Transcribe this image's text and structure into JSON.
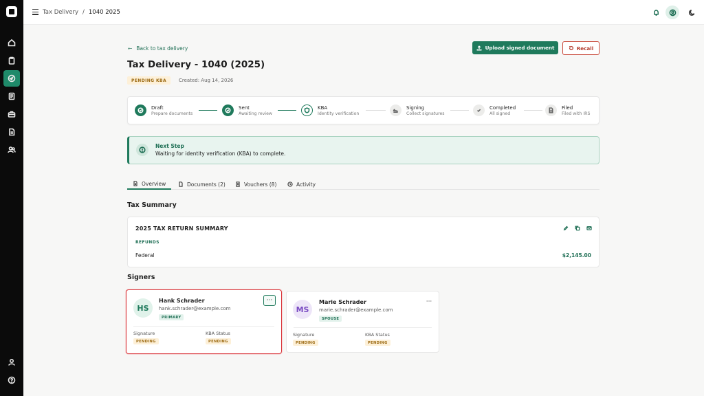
{
  "sidebar": {
    "items": [
      {
        "icon": "home-icon"
      },
      {
        "icon": "clipboard-icon"
      },
      {
        "icon": "tax-delivery-icon",
        "active": true
      },
      {
        "icon": "document-icon"
      },
      {
        "icon": "briefcase-icon"
      },
      {
        "icon": "file-icon"
      },
      {
        "icon": "users-icon"
      }
    ],
    "bottom": [
      {
        "icon": "user-icon"
      },
      {
        "icon": "help-icon"
      }
    ]
  },
  "header": {
    "breadcrumb": [
      "Tax Delivery",
      "/",
      "1040 2025"
    ],
    "icons": [
      "bell-icon",
      "account-icon",
      "dark-mode-icon"
    ]
  },
  "page": {
    "back_label": "Back to tax delivery",
    "title": "Tax Delivery - 1040 (2025)",
    "status_badge": "PENDING KBA",
    "created": "Created: Aug 14, 2026",
    "upload_label": "Upload signed document",
    "recall_label": "Recall"
  },
  "stepper": {
    "steps": [
      {
        "title": "Draft",
        "subtitle": "Prepare documents",
        "state": "done"
      },
      {
        "title": "Sent",
        "subtitle": "Awaiting review",
        "state": "done"
      },
      {
        "title": "KBA",
        "subtitle": "Identity verification",
        "state": "current"
      },
      {
        "title": "Signing",
        "subtitle": "Collect signatures",
        "state": "future"
      },
      {
        "title": "Completed",
        "subtitle": "All signed",
        "state": "future"
      },
      {
        "title": "Filed",
        "subtitle": "Filed with IRS",
        "state": "future"
      }
    ]
  },
  "next_step": {
    "title": "Next Step",
    "text": "Waiting for identity verification (KBA) to complete."
  },
  "tabs": [
    {
      "label": "Overview",
      "active": true
    },
    {
      "label": "Documents (2)"
    },
    {
      "label": "Vouchers (8)"
    },
    {
      "label": "Activity"
    }
  ],
  "tax_summary": {
    "section_title": "Tax Summary",
    "card_title": "2025 TAX RETURN SUMMARY",
    "refunds_label": "REFUNDS",
    "rows": [
      {
        "label": "Federal",
        "value": "$2,145.00"
      }
    ]
  },
  "signers": {
    "section_title": "Signers",
    "list": [
      {
        "initials": "HS",
        "name": "Hank Schrader",
        "email": "hank.schrader@example.com",
        "role": "PRIMARY",
        "signature_label": "Signature",
        "signature_status": "PENDING",
        "kba_label": "KBA Status",
        "kba_status": "PENDING"
      },
      {
        "initials": "MS",
        "name": "Marie Schrader",
        "email": "marie.schrader@example.com",
        "role": "SPOUSE",
        "signature_label": "Signature",
        "signature_status": "PENDING",
        "kba_label": "KBA Status",
        "kba_status": "PENDING"
      }
    ],
    "more_label": "···"
  },
  "colors": {
    "accent": "#1f7a5c",
    "danger": "#c94a3c",
    "pending_bg": "#fdf0d8",
    "pending_text": "#9c6a12",
    "sidebar_bg": "#0b0b0b"
  }
}
